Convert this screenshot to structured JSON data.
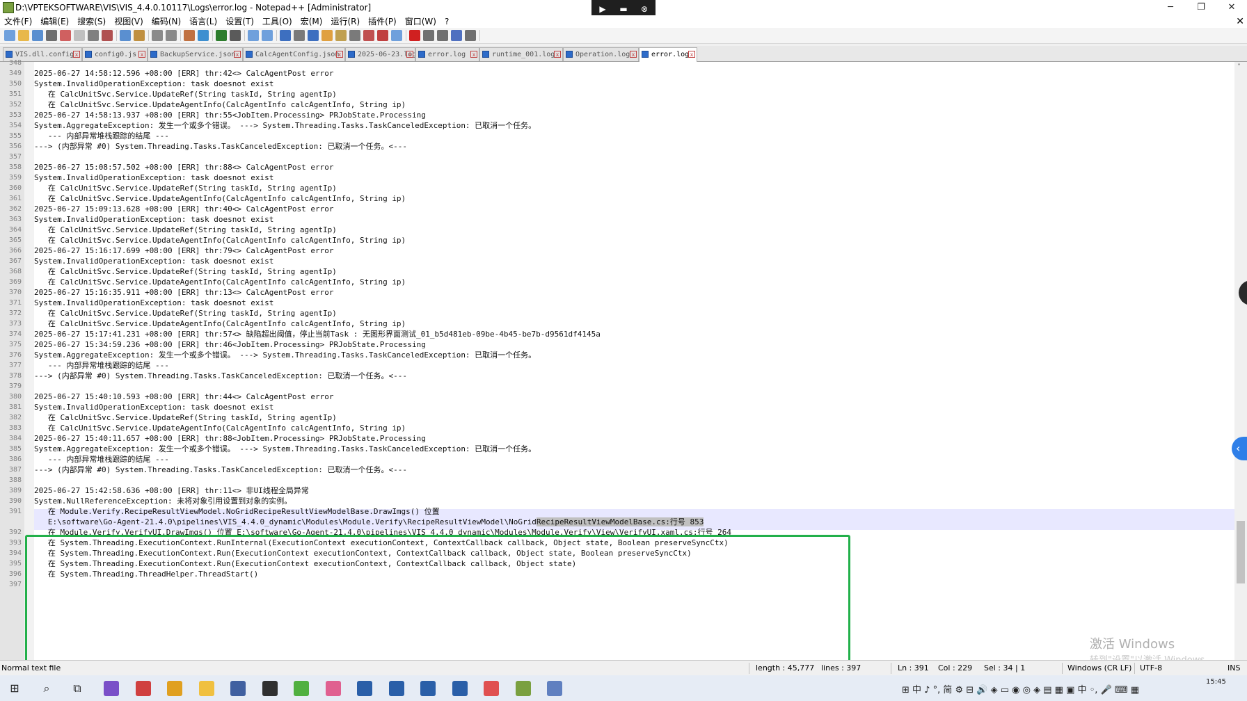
{
  "window": {
    "title": "D:\\VPTEKSOFTWARE\\VIS\\VIS_4.4.0.10117\\Logs\\error.log - Notepad++ [Administrator]",
    "min_glyph": "─",
    "max_glyph": "❐",
    "close_glyph": "✕"
  },
  "remote_bar": {
    "pin_glyph": "▶",
    "screen_glyph": "▬",
    "close_glyph": "⊗"
  },
  "menu": {
    "items": [
      "文件(F)",
      "编辑(E)",
      "搜索(S)",
      "视图(V)",
      "编码(N)",
      "语言(L)",
      "设置(T)",
      "工具(O)",
      "宏(M)",
      "运行(R)",
      "插件(P)",
      "窗口(W)",
      "?"
    ],
    "close_glyph": "✕"
  },
  "toolbar": {
    "colors": [
      "#6fa0dc",
      "#e8b84a",
      "#5a8fd0",
      "#6e6e6e",
      "#d06060",
      "#c0c0c0",
      "#808080",
      "#b05050",
      "#5a8fd0",
      "#c09040",
      "#8a8a8a",
      "#8a8a8a",
      "#c07040",
      "#3d8fd0",
      "#2d7d2d",
      "#5a5a5a",
      "#6fa0dc",
      "#6fa0dc",
      "#3d6fc0",
      "#7a7a7a",
      "#3d6fc0",
      "#e0a040",
      "#c0a050",
      "#7a7a7a",
      "#c05050",
      "#c04040",
      "#6fa0dc",
      "#d02020",
      "#707070",
      "#707070",
      "#5070c0",
      "#707070"
    ]
  },
  "tabs": [
    {
      "label": "VIS.dll.config",
      "active": false
    },
    {
      "label": "config0.js",
      "active": false
    },
    {
      "label": "BackupService.json",
      "active": false
    },
    {
      "label": "CalcAgentConfig.json",
      "active": false
    },
    {
      "label": "2025-06-23.log",
      "active": false
    },
    {
      "label": "error.log",
      "active": false
    },
    {
      "label": "runtime_001.log",
      "active": false
    },
    {
      "label": "Operation.log",
      "active": false
    },
    {
      "label": "error.log",
      "active": true
    }
  ],
  "editor": {
    "lines": [
      {
        "num": "348",
        "text": ""
      },
      {
        "num": "349",
        "text": "2025-06-27 14:58:12.596 +08:00 [ERR] thr:42<> CalcAgentPost error"
      },
      {
        "num": "350",
        "text": "System.InvalidOperationException: task doesnot exist"
      },
      {
        "num": "351",
        "text": "   在 CalcUnitSvc.Service.UpdateRef(String taskId, String agentIp)"
      },
      {
        "num": "352",
        "text": "   在 CalcUnitSvc.Service.UpdateAgentInfo(CalcAgentInfo calcAgentInfo, String ip)"
      },
      {
        "num": "353",
        "text": "2025-06-27 14:58:13.937 +08:00 [ERR] thr:55<JobItem.Processing> PRJobState.Processing"
      },
      {
        "num": "354",
        "text": "System.AggregateException: 发生一个或多个错误。 ---> System.Threading.Tasks.TaskCanceledException: 已取消一个任务。"
      },
      {
        "num": "355",
        "text": "   --- 内部异常堆栈跟踪的结尾 ---"
      },
      {
        "num": "356",
        "text": "---> (内部异常 #0) System.Threading.Tasks.TaskCanceledException: 已取消一个任务。<---"
      },
      {
        "num": "357",
        "text": ""
      },
      {
        "num": "358",
        "text": "2025-06-27 15:08:57.502 +08:00 [ERR] thr:88<> CalcAgentPost error"
      },
      {
        "num": "359",
        "text": "System.InvalidOperationException: task doesnot exist"
      },
      {
        "num": "360",
        "text": "   在 CalcUnitSvc.Service.UpdateRef(String taskId, String agentIp)"
      },
      {
        "num": "361",
        "text": "   在 CalcUnitSvc.Service.UpdateAgentInfo(CalcAgentInfo calcAgentInfo, String ip)"
      },
      {
        "num": "362",
        "text": "2025-06-27 15:09:13.628 +08:00 [ERR] thr:40<> CalcAgentPost error"
      },
      {
        "num": "363",
        "text": "System.InvalidOperationException: task doesnot exist"
      },
      {
        "num": "364",
        "text": "   在 CalcUnitSvc.Service.UpdateRef(String taskId, String agentIp)"
      },
      {
        "num": "365",
        "text": "   在 CalcUnitSvc.Service.UpdateAgentInfo(CalcAgentInfo calcAgentInfo, String ip)"
      },
      {
        "num": "366",
        "text": "2025-06-27 15:16:17.699 +08:00 [ERR] thr:79<> CalcAgentPost error"
      },
      {
        "num": "367",
        "text": "System.InvalidOperationException: task doesnot exist"
      },
      {
        "num": "368",
        "text": "   在 CalcUnitSvc.Service.UpdateRef(String taskId, String agentIp)"
      },
      {
        "num": "369",
        "text": "   在 CalcUnitSvc.Service.UpdateAgentInfo(CalcAgentInfo calcAgentInfo, String ip)"
      },
      {
        "num": "370",
        "text": "2025-06-27 15:16:35.911 +08:00 [ERR] thr:13<> CalcAgentPost error"
      },
      {
        "num": "371",
        "text": "System.InvalidOperationException: task doesnot exist"
      },
      {
        "num": "372",
        "text": "   在 CalcUnitSvc.Service.UpdateRef(String taskId, String agentIp)"
      },
      {
        "num": "373",
        "text": "   在 CalcUnitSvc.Service.UpdateAgentInfo(CalcAgentInfo calcAgentInfo, String ip)"
      },
      {
        "num": "374",
        "text": "2025-06-27 15:17:41.231 +08:00 [ERR] thr:57<> 缺陷超出阈值，停止当前Task : 无图形界面测试_01_b5d481eb-09be-4b45-be7b-d9561df4145a"
      },
      {
        "num": "375",
        "text": "2025-06-27 15:34:59.236 +08:00 [ERR] thr:46<JobItem.Processing> PRJobState.Processing"
      },
      {
        "num": "376",
        "text": "System.AggregateException: 发生一个或多个错误。 ---> System.Threading.Tasks.TaskCanceledException: 已取消一个任务。"
      },
      {
        "num": "377",
        "text": "   --- 内部异常堆栈跟踪的结尾 ---"
      },
      {
        "num": "378",
        "text": "---> (内部异常 #0) System.Threading.Tasks.TaskCanceledException: 已取消一个任务。<---"
      },
      {
        "num": "379",
        "text": ""
      },
      {
        "num": "380",
        "text": "2025-06-27 15:40:10.593 +08:00 [ERR] thr:44<> CalcAgentPost error"
      },
      {
        "num": "381",
        "text": "System.InvalidOperationException: task doesnot exist"
      },
      {
        "num": "382",
        "text": "   在 CalcUnitSvc.Service.UpdateRef(String taskId, String agentIp)"
      },
      {
        "num": "383",
        "text": "   在 CalcUnitSvc.Service.UpdateAgentInfo(CalcAgentInfo calcAgentInfo, String ip)"
      },
      {
        "num": "384",
        "text": "2025-06-27 15:40:11.657 +08:00 [ERR] thr:88<JobItem.Processing> PRJobState.Processing"
      },
      {
        "num": "385",
        "text": "System.AggregateException: 发生一个或多个错误。 ---> System.Threading.Tasks.TaskCanceledException: 已取消一个任务。"
      },
      {
        "num": "386",
        "text": "   --- 内部异常堆栈跟踪的结尾 ---"
      },
      {
        "num": "387",
        "text": "---> (内部异常 #0) System.Threading.Tasks.TaskCanceledException: 已取消一个任务。<---"
      },
      {
        "num": "388",
        "text": ""
      },
      {
        "num": "389",
        "text": "2025-06-27 15:42:58.636 +08:00 [ERR] thr:11<> 非UI线程全局异常"
      },
      {
        "num": "390",
        "text": "System.NullReferenceException: 未将对象引用设置到对象的实例。"
      },
      {
        "num": "391",
        "text": "   在 Module.Verify.RecipeResultViewModel.NoGridRecipeResultViewModelBase.DrawImgs() 位置"
      },
      {
        "num": "",
        "text_pre": "   E:\\software\\Go-Agent-21.4.0\\pipelines\\VIS_4.4.0_dynamic\\Modules\\Module.Verify\\RecipeResultViewModel\\NoGrid",
        "text_sel": "RecipeResultViewModelBase.cs:行号 853",
        "text_post": ""
      },
      {
        "num": "392",
        "text": "   在 Module.Verify.VerifyUI.DrawImgs() 位置 E:\\software\\Go-Agent-21.4.0\\pipelines\\VIS_4.4.0_dynamic\\Modules\\Module.Verify\\View\\VerifyUI.xaml.cs:行号 264"
      },
      {
        "num": "393",
        "text": "   在 System.Threading.ExecutionContext.RunInternal(ExecutionContext executionContext, ContextCallback callback, Object state, Boolean preserveSyncCtx)"
      },
      {
        "num": "394",
        "text": "   在 System.Threading.ExecutionContext.Run(ExecutionContext executionContext, ContextCallback callback, Object state, Boolean preserveSyncCtx)"
      },
      {
        "num": "395",
        "text": "   在 System.Threading.ExecutionContext.Run(ExecutionContext executionContext, ContextCallback callback, Object state)"
      },
      {
        "num": "396",
        "text": "   在 System.Threading.ThreadHelper.ThreadStart()"
      },
      {
        "num": "397",
        "text": ""
      }
    ]
  },
  "scroll": {
    "up_glyph": "˄"
  },
  "side_widget": {
    "chevron_glyph": "‹"
  },
  "watermark": {
    "line1": "激活 Windows",
    "line2": "转到\"设置\"以激活 Windows。"
  },
  "status": {
    "file_type": "Normal text file",
    "length": "length : 45,777",
    "lines": "lines : 397",
    "ln": "Ln : 391",
    "col": "Col : 229",
    "sel": "Sel : 34 | 1",
    "eol": "Windows (CR LF)",
    "encoding": "UTF-8",
    "mode": "INS"
  },
  "taskbar": {
    "start_glyph": "⊞",
    "search_glyph": "⌕",
    "taskview_glyph": "⧉",
    "apps": [
      {
        "name": "visual-studio-icon",
        "color": "#7a4fc8"
      },
      {
        "name": "app-bird-icon",
        "color": "#d04040"
      },
      {
        "name": "chrome-icon",
        "color": "#e0a020"
      },
      {
        "name": "file-explorer-icon",
        "color": "#f0c040"
      },
      {
        "name": "app-terminal-icon",
        "color": "#4060a0"
      },
      {
        "name": "msg-icon",
        "color": "#303030"
      },
      {
        "name": "app-green-icon",
        "color": "#50b040"
      },
      {
        "name": "app-store-icon",
        "color": "#e06090"
      },
      {
        "name": "vis-app-icon",
        "color": "#2a5fa8"
      },
      {
        "name": "vis-app-icon",
        "color": "#2a5fa8"
      },
      {
        "name": "vis-app-icon",
        "color": "#2a5fa8"
      },
      {
        "name": "vis-app-icon",
        "color": "#2a5fa8"
      },
      {
        "name": "app-grid-icon",
        "color": "#e05050"
      },
      {
        "name": "notepadpp-icon",
        "color": "#7aa040"
      },
      {
        "name": "app-device-icon",
        "color": "#6080c0"
      }
    ],
    "tray_text": "⊞ 中 ♪ °, 简 ⚙    ⊟ 🔊 ◈ ▭ ◉ ◎ ◈ ▤ ▦ ▣    中 ◦, 🎤 ⌨ ▦",
    "clock_time": "15:45"
  }
}
